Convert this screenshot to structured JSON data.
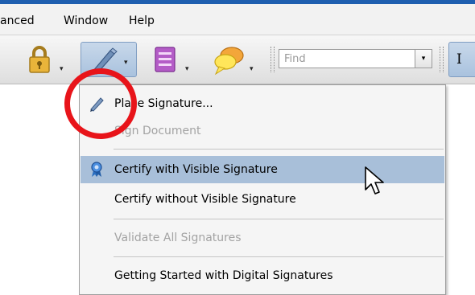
{
  "menubar": {
    "items": [
      "anced",
      "Window",
      "Help"
    ]
  },
  "toolbar": {
    "lock_button": {
      "icon": "lock-icon",
      "arrow": "▾"
    },
    "sign_button": {
      "icon": "pen-icon",
      "arrow": "▾",
      "pressed": true
    },
    "form_button": {
      "icon": "form-icon",
      "arrow": "▾"
    },
    "comment_button": {
      "icon": "speech-bubble-icon",
      "arrow": "▾"
    },
    "find": {
      "placeholder": "Find",
      "arrow": "▾"
    },
    "text_tool": {
      "icon": "text-select-icon",
      "label": "I"
    }
  },
  "dropdown": {
    "items": [
      {
        "label": "Place Signature...",
        "enabled": true,
        "icon": "pen-icon"
      },
      {
        "label": "Sign Document",
        "enabled": false
      },
      {
        "label": "Certify with Visible Signature",
        "enabled": true,
        "highlighted": true,
        "icon": "ribbon-icon"
      },
      {
        "label": "Certify without Visible Signature",
        "enabled": true
      },
      {
        "label": "Validate All Signatures",
        "enabled": false
      },
      {
        "label": "Getting Started with Digital Signatures",
        "enabled": true
      }
    ]
  },
  "annotation": {
    "color": "#e8141a",
    "shape": "circle"
  },
  "colors": {
    "accent": "#1f5fb0",
    "highlight": "#a8bfd9",
    "disabled_text": "#a3a3a3"
  }
}
